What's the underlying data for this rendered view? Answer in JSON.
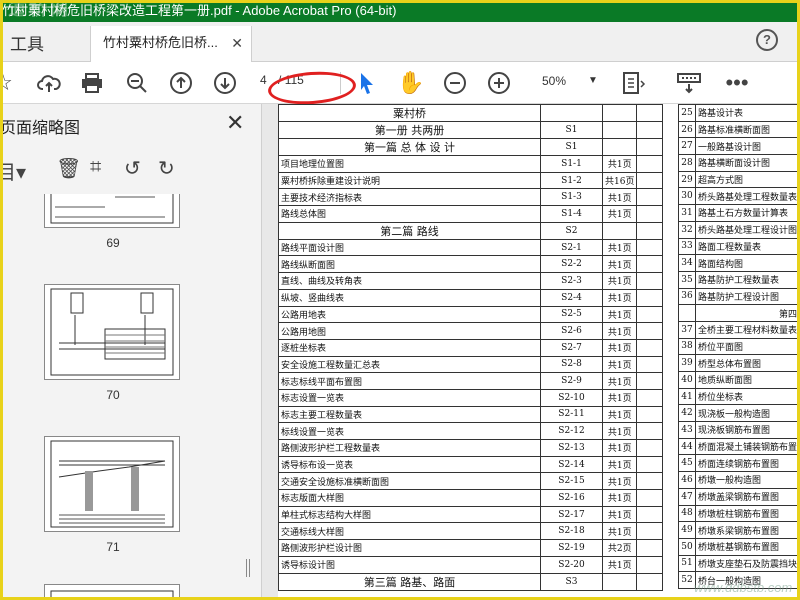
{
  "window": {
    "title": "竹村栗村桥危旧桥梁改造工程第一册.pdf - Adobe Acrobat Pro (64-bit)",
    "watermark": "道桥网"
  },
  "tabs": {
    "tools_label": "工具",
    "doc_label": "竹村粟村桥危旧桥...",
    "close_icon": "close-icon",
    "help_label": "?"
  },
  "toolbar": {
    "page_current": "4",
    "page_total": "/ 115",
    "zoom": "50%",
    "icons": [
      "star-icon",
      "upload-cloud-icon",
      "print-icon",
      "zoom-out-search-icon",
      "arrow-up-circle-icon",
      "arrow-down-circle-icon",
      "select-arrow-icon",
      "hand-icon",
      "minus-circle-icon",
      "plus-circle-icon",
      "page-fit-icon",
      "scroll-mode-icon",
      "more-icon"
    ],
    "accent": "#1a73e8"
  },
  "sidebar": {
    "title": "页面缩略图",
    "tools": [
      "options-icon",
      "delete-icon",
      "crop-icon",
      "undo-icon",
      "redo-icon"
    ],
    "thumbnails": [
      {
        "num": "69"
      },
      {
        "num": "70"
      },
      {
        "num": "71"
      },
      {
        "num": ""
      }
    ]
  },
  "document": {
    "rows": [
      {
        "name": "粟村桥",
        "code": "",
        "pages": "",
        "type": "header"
      },
      {
        "name": "第一册  共两册",
        "code": "S1",
        "pages": "",
        "type": "header"
      },
      {
        "name": "第一篇     总 体 设 计",
        "code": "S1",
        "pages": "",
        "type": "header"
      },
      {
        "name": "项目地理位置图",
        "code": "S1-1",
        "pages": "共1页"
      },
      {
        "name": "粟村桥拆除重建设计说明",
        "code": "S1-2",
        "pages": "共16页"
      },
      {
        "name": "主要技术经济指标表",
        "code": "S1-3",
        "pages": "共1页"
      },
      {
        "name": "路线总体图",
        "code": "S1-4",
        "pages": "共1页"
      },
      {
        "name": "第二篇    路线",
        "code": "S2",
        "pages": "",
        "type": "header"
      },
      {
        "name": "路线平面设计图",
        "code": "S2-1",
        "pages": "共1页"
      },
      {
        "name": "路线纵断面图",
        "code": "S2-2",
        "pages": "共1页"
      },
      {
        "name": "直线、曲线及转角表",
        "code": "S2-3",
        "pages": "共1页"
      },
      {
        "name": "纵坡、竖曲线表",
        "code": "S2-4",
        "pages": "共1页"
      },
      {
        "name": "公路用地表",
        "code": "S2-5",
        "pages": "共1页"
      },
      {
        "name": "公路用地图",
        "code": "S2-6",
        "pages": "共1页"
      },
      {
        "name": "逐桩坐标表",
        "code": "S2-7",
        "pages": "共1页"
      },
      {
        "name": "安全设施工程数量汇总表",
        "code": "S2-8",
        "pages": "共1页"
      },
      {
        "name": "标志标线平面布置图",
        "code": "S2-9",
        "pages": "共1页"
      },
      {
        "name": "标志设置一览表",
        "code": "S2-10",
        "pages": "共1页"
      },
      {
        "name": "标志主要工程数量表",
        "code": "S2-11",
        "pages": "共1页"
      },
      {
        "name": "标线设置一览表",
        "code": "S2-12",
        "pages": "共1页"
      },
      {
        "name": "路侧波形护栏工程数量表",
        "code": "S2-13",
        "pages": "共1页"
      },
      {
        "name": "诱导标布设一览表",
        "code": "S2-14",
        "pages": "共1页"
      },
      {
        "name": "交通安全设施标准横断面图",
        "code": "S2-15",
        "pages": "共1页"
      },
      {
        "name": "标志版面大样图",
        "code": "S2-16",
        "pages": "共1页"
      },
      {
        "name": "单柱式标志结构大样图",
        "code": "S2-17",
        "pages": "共1页"
      },
      {
        "name": "交通标线大样图",
        "code": "S2-18",
        "pages": "共1页"
      },
      {
        "name": "路侧波形护栏设计图",
        "code": "S2-19",
        "pages": "共2页"
      },
      {
        "name": "诱导标设计图",
        "code": "S2-20",
        "pages": "共1页"
      },
      {
        "name": "第三篇    路基、路面",
        "code": "S3",
        "pages": "",
        "type": "header"
      }
    ],
    "right_rows": [
      {
        "num": "25",
        "name": "路基设计表"
      },
      {
        "num": "26",
        "name": "路基标准横断面图"
      },
      {
        "num": "27",
        "name": "一般路基设计图"
      },
      {
        "num": "28",
        "name": "路基横断面设计图"
      },
      {
        "num": "29",
        "name": "超高方式图"
      },
      {
        "num": "30",
        "name": "桥头路基处理工程数量表"
      },
      {
        "num": "31",
        "name": "路基土石方数量计算表"
      },
      {
        "num": "32",
        "name": "桥头路基处理工程设计图"
      },
      {
        "num": "33",
        "name": "路面工程数量表"
      },
      {
        "num": "34",
        "name": "路面结构图"
      },
      {
        "num": "35",
        "name": "路基防护工程数量表"
      },
      {
        "num": "36",
        "name": "路基防护工程设计图"
      },
      {
        "num": "",
        "name": "第四"
      },
      {
        "num": "37",
        "name": "全桥主要工程材料数量表"
      },
      {
        "num": "38",
        "name": "桥位平面图"
      },
      {
        "num": "39",
        "name": "桥型总体布置图"
      },
      {
        "num": "40",
        "name": "地质纵断面图"
      },
      {
        "num": "41",
        "name": "桥位坐标表"
      },
      {
        "num": "42",
        "name": "现浇板一般构造图"
      },
      {
        "num": "43",
        "name": "现浇板钢筋布置图"
      },
      {
        "num": "44",
        "name": "桥面混凝土铺装钢筋布置"
      },
      {
        "num": "45",
        "name": "桥面连续钢筋布置图"
      },
      {
        "num": "46",
        "name": "桥墩一般构造图"
      },
      {
        "num": "47",
        "name": "桥墩盖梁钢筋布置图"
      },
      {
        "num": "48",
        "name": "桥墩桩柱钢筋布置图"
      },
      {
        "num": "49",
        "name": "桥墩系梁钢筋布置图"
      },
      {
        "num": "50",
        "name": "桥墩桩基钢筋布置图"
      },
      {
        "num": "51",
        "name": "桥墩支座垫石及防震挡块"
      },
      {
        "num": "52",
        "name": "桥台一般构造图"
      }
    ]
  },
  "footer_watermark": "www.ddbstb.com"
}
